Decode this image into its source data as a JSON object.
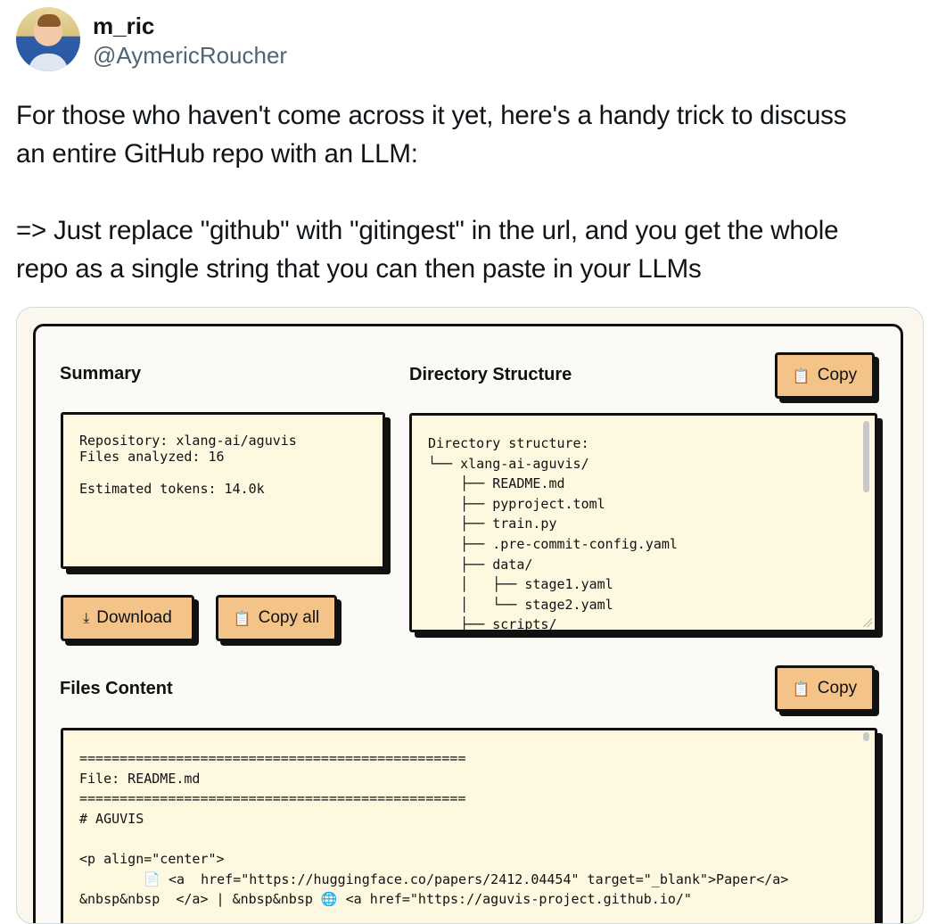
{
  "tweet": {
    "display_name": "m_ric",
    "handle": "@AymericRoucher",
    "avatar_icon": "profile-photo",
    "text_line_1": "For those who haven't come across it yet, here's a handy trick to discuss",
    "text_line_2": "an entire GitHub repo with an LLM:",
    "text_line_3": "=> Just replace \"github\" with \"gitingest\" in the url, and you get the whole",
    "text_line_4": "repo as a single string that you can then paste in your LLMs"
  },
  "app": {
    "summary": {
      "title": "Summary",
      "lines": "Repository: xlang-ai/aguvis\nFiles analyzed: 16\n\nEstimated tokens: 14.0k"
    },
    "download_button": {
      "label": "Download",
      "icon": "download-icon",
      "glyph": "⤓"
    },
    "copy_all_button": {
      "label": "Copy all",
      "icon": "clipboard-icon",
      "glyph": "📋"
    },
    "directory": {
      "title": "Directory Structure",
      "copy_label": "Copy",
      "text": "Directory structure:\n└── xlang-ai-aguvis/\n    ├── README.md\n    ├── pyproject.toml\n    ├── train.py\n    ├── .pre-commit-config.yaml\n    ├── data/\n    │   ├── stage1.yaml\n    │   └── stage2.yaml\n    ├── scripts/"
    },
    "files": {
      "title": "Files Content",
      "copy_label": "Copy",
      "text": "================================================\nFile: README.md\n================================================\n# AGUVIS\n\n<p align=\"center\">\n        📄 <a  href=\"https://huggingface.co/papers/2412.04454\" target=\"_blank\">Paper</a>\n&nbsp&nbsp  </a> | &nbsp&nbsp 🌐 <a href=\"https://aguvis-project.github.io/\""
    },
    "colors": {
      "accent": "#f3c387",
      "panel": "#fff8e0",
      "border": "#111111"
    }
  }
}
